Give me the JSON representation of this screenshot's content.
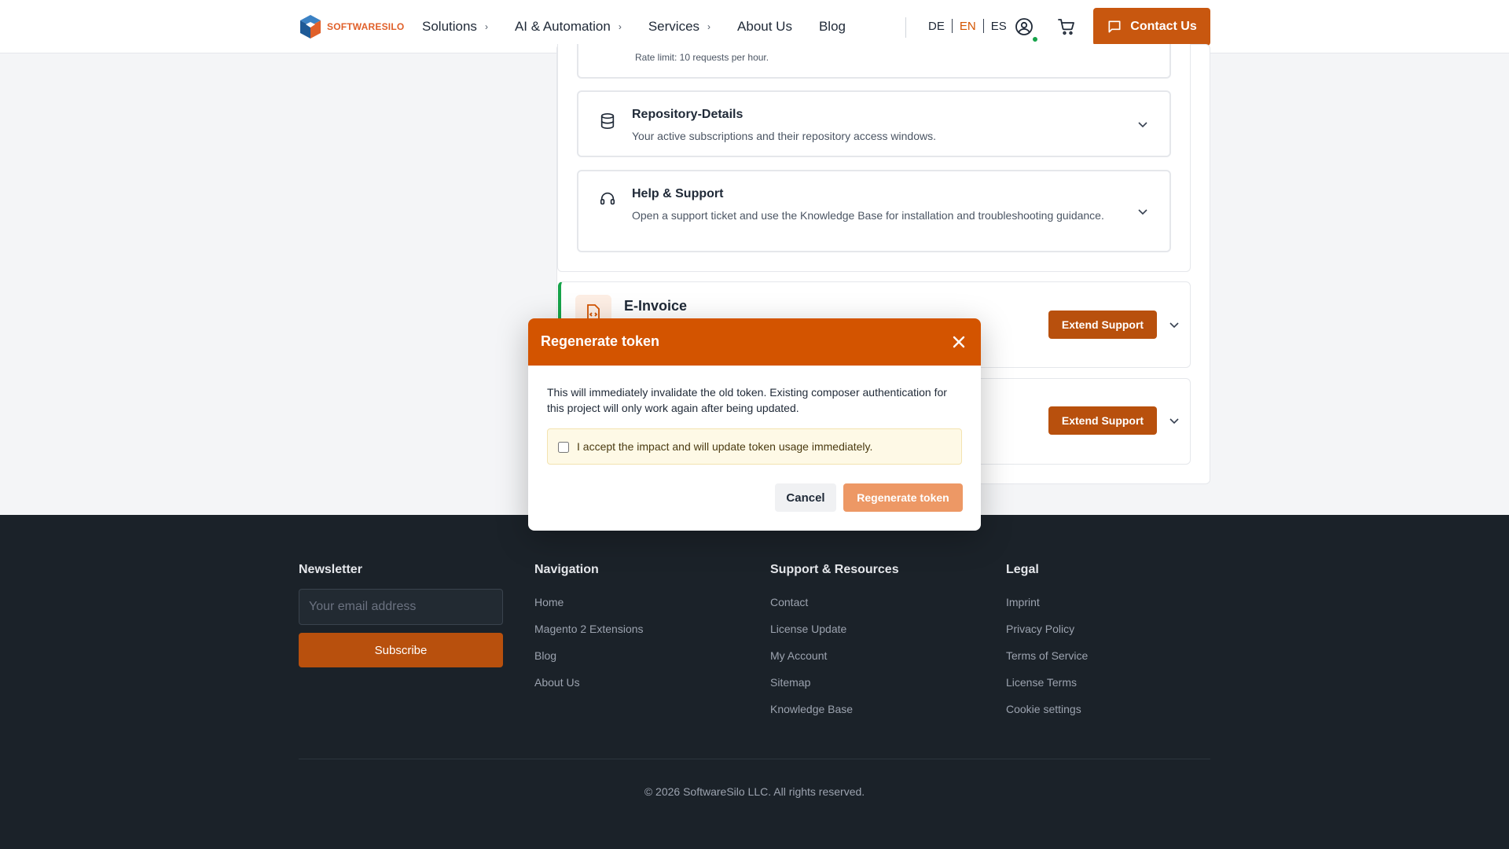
{
  "header": {
    "logo_text": "SOFTWARESILO",
    "nav": [
      {
        "label": "Solutions",
        "has_chevron": true
      },
      {
        "label": "AI & Automation",
        "has_chevron": true
      },
      {
        "label": "Services",
        "has_chevron": true
      },
      {
        "label": "About Us",
        "has_chevron": false
      },
      {
        "label": "Blog",
        "has_chevron": false
      }
    ],
    "languages": [
      "DE",
      "EN",
      "ES"
    ],
    "active_language": "EN",
    "contact_label": "Contact Us",
    "accent_color": "#c8570f"
  },
  "account": {
    "rate_limit_text": "Rate limit: 10 requests per hour.",
    "sections": [
      {
        "icon": "database-icon",
        "title": "Repository-Details",
        "description": "Your active subscriptions and their repository access windows."
      },
      {
        "icon": "headset-icon",
        "title": "Help & Support",
        "description": "Open a support ticket and use the Knowledge Base for installation and troubleshooting guidance."
      }
    ],
    "products": [
      {
        "title": "E-Invoice",
        "button": "Extend Support",
        "status_color": "#16a34a"
      },
      {
        "title": "",
        "button": "Extend Support"
      }
    ]
  },
  "modal": {
    "title": "Regenerate token",
    "body": "This will immediately invalidate the old token. Existing composer authentication for this project will only work again after being updated.",
    "accept_label": "I accept the impact and will update token usage immediately.",
    "accept_checked": false,
    "cancel_label": "Cancel",
    "confirm_label": "Regenerate token",
    "header_color": "#d35400"
  },
  "footer": {
    "newsletter": {
      "heading": "Newsletter",
      "placeholder": "Your email address",
      "button": "Subscribe"
    },
    "navigation": {
      "heading": "Navigation",
      "links": [
        "Home",
        "Magento 2 Extensions",
        "Blog",
        "About Us"
      ]
    },
    "support": {
      "heading": "Support & Resources",
      "links": [
        "Contact",
        "License Update",
        "My Account",
        "Sitemap",
        "Knowledge Base"
      ]
    },
    "legal": {
      "heading": "Legal",
      "links": [
        "Imprint",
        "Privacy Policy",
        "Terms of Service",
        "License Terms",
        "Cookie settings"
      ]
    },
    "copyright": "© 2026 SoftwareSilo LLC. All rights reserved."
  }
}
